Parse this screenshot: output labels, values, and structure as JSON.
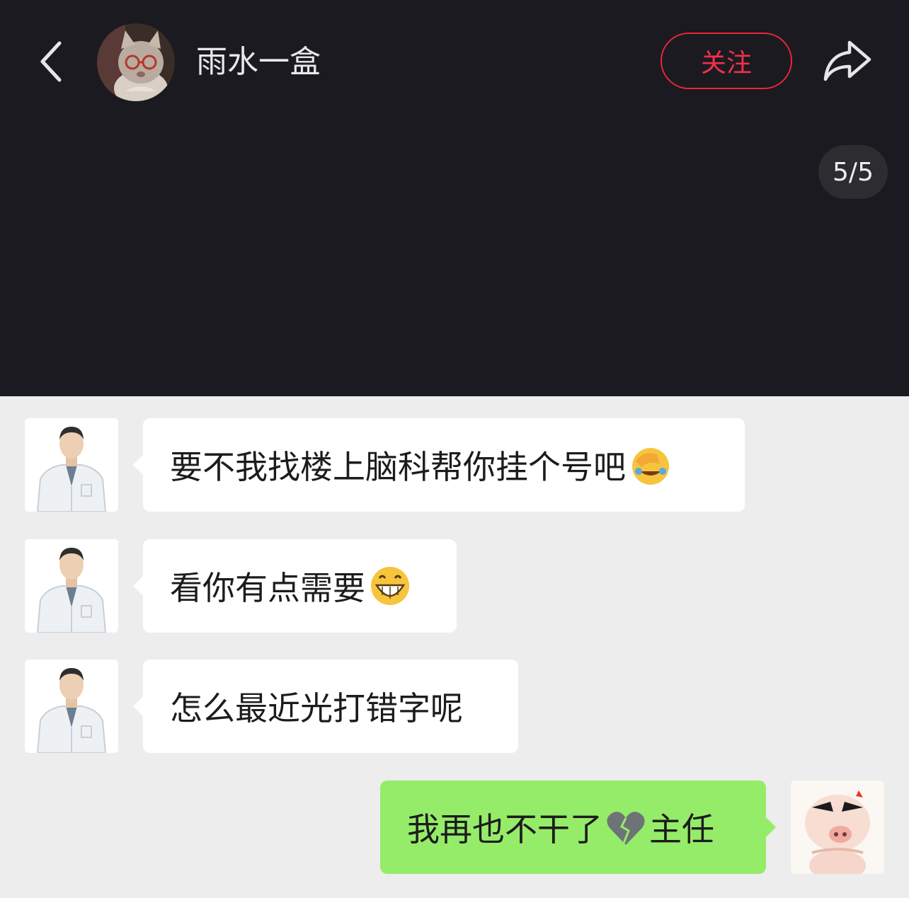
{
  "header": {
    "username": "雨水一盒",
    "follow_label": "关注",
    "back_icon": "chevron-left-icon",
    "share_icon": "share-icon",
    "avatar": "cat-avatar"
  },
  "image_counter": "5/5",
  "colors": {
    "header_bg": "#1a1a20",
    "follow_red": "#f23048",
    "chat_bg": "#ededed",
    "bubble_white": "#ffffff",
    "bubble_green": "#95ec69"
  },
  "messages": [
    {
      "side": "left",
      "text": "要不我找楼上脑科帮你挂个号吧",
      "emoji": "face-palm-laughing-emoji"
    },
    {
      "side": "left",
      "text": "看你有点需要",
      "emoji": "grinning-emoji"
    },
    {
      "side": "left",
      "text": "怎么最近光打错字呢"
    },
    {
      "side": "right",
      "text_before": "我再也不干了",
      "emoji": "broken-heart-emoji",
      "text_after": "主任"
    }
  ]
}
